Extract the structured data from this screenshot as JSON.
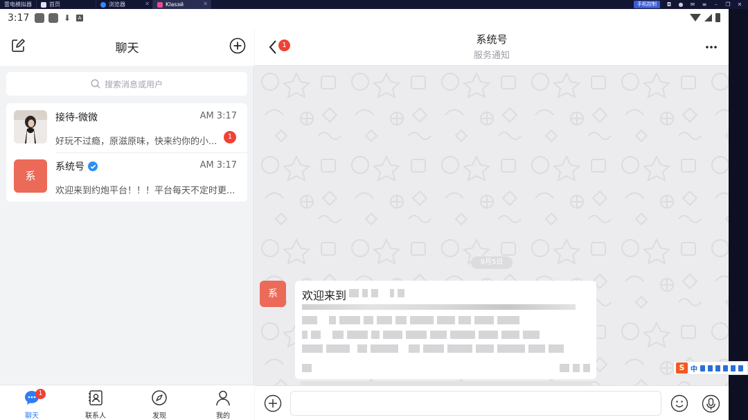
{
  "emulator": {
    "tabs": [
      {
        "label": "雷电模拟器",
        "icon_color": "#6c7bd9"
      },
      {
        "label": "首页",
        "icon_color": "#ffffff"
      },
      {
        "label": "浏览器",
        "icon_color": "#2f8cff"
      },
      {
        "label": "Klasэй",
        "icon_color": "#e84c8c"
      }
    ],
    "phone_control_label": "手机控制"
  },
  "statusbar": {
    "time": "3:17"
  },
  "left": {
    "title": "聊天",
    "search_placeholder": "搜索消息或用户",
    "chats": [
      {
        "name": "接待-微微",
        "time": "AM 3:17",
        "message": "好玩不过瘾，原滋原味，快来约你的小...",
        "unread": "1",
        "verified": false
      },
      {
        "name": "系统号",
        "time": "AM 3:17",
        "message": "欢迎来到约炮平台！！！平台每天不定时更...",
        "unread": "",
        "verified": true,
        "avatar_text": "系"
      }
    ],
    "nav": [
      {
        "label": "聊天",
        "badge": "1",
        "icon": "chat-bubble-icon",
        "active": true
      },
      {
        "label": "联系人",
        "badge": "",
        "icon": "contacts-icon",
        "active": false
      },
      {
        "label": "发现",
        "badge": "",
        "icon": "compass-icon",
        "active": false
      },
      {
        "label": "我的",
        "badge": "",
        "icon": "profile-icon",
        "active": false
      }
    ]
  },
  "right": {
    "title": "系统号",
    "subtitle": "服务通知",
    "back_badge": "1",
    "date_chip": "9月5日",
    "message": {
      "avatar_text": "系",
      "first_line": "欢迎来到"
    },
    "input_placeholder": ""
  },
  "ime": {
    "logo": "S",
    "label": "中"
  },
  "colors": {
    "accent_blue": "#2e7cf6",
    "badge_red": "#f04135",
    "system_avatar": "#eb6a58",
    "verify_blue": "#2e8ef0"
  }
}
